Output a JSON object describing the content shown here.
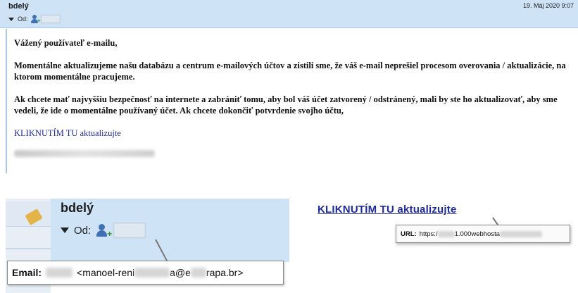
{
  "email": {
    "sender": "bdelý",
    "date": "19. Máj 2020 9:07",
    "from_label": "Od:",
    "greeting": "Vážený používateľ e-mailu,",
    "paragraph1": "Momentálne aktualizujeme našu databázu a centrum e-mailových účtov a zistili sme, že váš e-mail neprešiel procesom overovania / aktualizácie, na ktorom momentálne pracujeme.",
    "paragraph2": "Ak chcete mať najvyššiu bezpečnosť na internete a zabrániť tomu, aby bol váš účet zatvorený / odstránený, mali by ste ho aktualizovať, aby sme vedeli, že ide o momentálne používaný účet. Ak chcete dokončiť potvrdenie svojho účtu,",
    "link_text": "KLIKNUTÍM TU aktualizujte"
  },
  "zoom_sender": {
    "sender": "bdelý",
    "from_label": "Od:",
    "email_label": "Email:",
    "email_part1": "<manoel-reni",
    "email_part2": "a@e",
    "email_part3": "rapa.br>"
  },
  "zoom_link": {
    "link_text": "KLIKNUTÍM TU aktualizujte",
    "url_label": "URL:",
    "url_part1": "https:/",
    "url_part2": "1.000webhosta"
  },
  "colors": {
    "header_bg": "#cfe3f7",
    "link": "#1f2a9c"
  },
  "icons": [
    "contact-add-icon",
    "tag-icon",
    "dropdown-caret-icon"
  ]
}
